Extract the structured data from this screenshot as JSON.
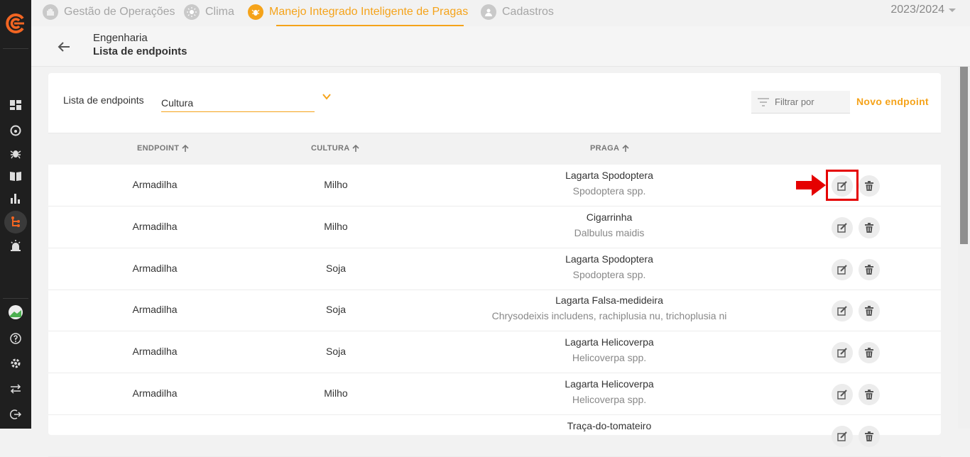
{
  "nav": {
    "items": [
      {
        "label": "Gestão de Operações",
        "icon": "hand-icon"
      },
      {
        "label": "Clima",
        "icon": "sun-icon"
      },
      {
        "label": "Manejo Integrado Inteligente de Pragas",
        "icon": "bug-icon"
      },
      {
        "label": "Cadastros",
        "icon": "user-icon"
      }
    ],
    "season": "2023/2024"
  },
  "breadcrumb": {
    "parent": "Engenharia",
    "title": "Lista de endpoints"
  },
  "toolbar": {
    "list_label": "Lista de endpoints",
    "culture_value": "Cultura",
    "filter_placeholder": "Filtrar por",
    "new_endpoint": "Novo endpoint"
  },
  "table": {
    "headers": [
      "ENDPOINT",
      "CULTURA",
      "PRAGA"
    ],
    "rows": [
      {
        "endpoint": "Armadilha",
        "cultura": "Milho",
        "praga": "Lagarta Spodoptera",
        "cientifico": "Spodoptera spp."
      },
      {
        "endpoint": "Armadilha",
        "cultura": "Milho",
        "praga": "Cigarrinha",
        "cientifico": "Dalbulus maidis"
      },
      {
        "endpoint": "Armadilha",
        "cultura": "Soja",
        "praga": "Lagarta Spodoptera",
        "cientifico": "Spodoptera spp."
      },
      {
        "endpoint": "Armadilha",
        "cultura": "Soja",
        "praga": "Lagarta Falsa-medideira",
        "cientifico": "Chrysodeixis includens, rachiplusia nu, trichoplusia ni"
      },
      {
        "endpoint": "Armadilha",
        "cultura": "Soja",
        "praga": "Lagarta Helicoverpa",
        "cientifico": "Helicoverpa spp."
      },
      {
        "endpoint": "Armadilha",
        "cultura": "Milho",
        "praga": "Lagarta Helicoverpa",
        "cientifico": "Helicoverpa spp."
      },
      {
        "endpoint": "",
        "cultura": "",
        "praga": "Traça-do-tomateiro",
        "cientifico": ""
      }
    ]
  },
  "colors": {
    "accent": "#f5a31a",
    "sidebar": "#1f1f1f",
    "highlight": "#e50000"
  }
}
